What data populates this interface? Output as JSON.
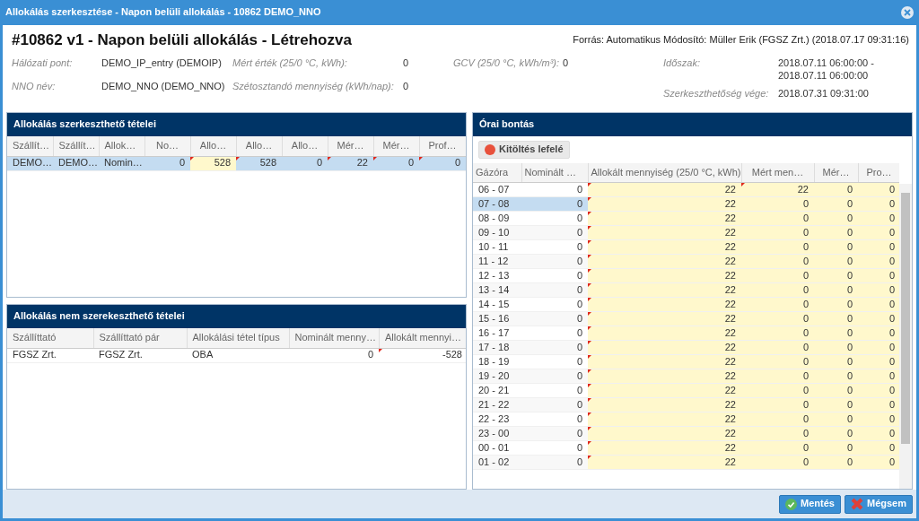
{
  "window": {
    "title": "Allokálás szerkesztése - Napon belüli allokálás - 10862 DEMO_NNO"
  },
  "header": {
    "title": "#10862 v1 - Napon belüli allokálás - Létrehozva",
    "source": "Forrás: Automatikus Módosító: Müller Erik (FGSZ Zrt.) (2018.07.17 09:31:16)",
    "fields": [
      {
        "label": "Hálózati pont:",
        "value": "DEMO_IP_entry (DEMOIP)"
      },
      {
        "label": "Mért érték (25/0 °C, kWh):",
        "value": "0"
      },
      {
        "label": "GCV (25/0 °C, kWh/m³):",
        "value": "0"
      },
      {
        "label": "NNO név:",
        "value": "DEMO_NNO (DEMO_NNO)"
      },
      {
        "label": "Szétosztandó mennyiség (kWh/nap):",
        "value": "0"
      }
    ],
    "period_fields": [
      {
        "label": "Időszak:",
        "value": "2018.07.11 06:00:00 - 2018.07.11 06:00:00"
      },
      {
        "label": "Szerkeszthetőség vége:",
        "value": "2018.07.31 09:31:00"
      }
    ]
  },
  "editable_items": {
    "title": "Allokálás szerkeszthető tételei",
    "columns": [
      "Szállít…",
      "Szállít…",
      "Allok…",
      "No…",
      "Allo…",
      "Allo…",
      "Allo…",
      "Mér…",
      "Mér…",
      "Prof…"
    ],
    "rows": [
      {
        "selected": true,
        "cells": [
          {
            "text": "DEMO…",
            "editable": false,
            "modified": false
          },
          {
            "text": "DEMO…",
            "editable": false,
            "modified": false
          },
          {
            "text": "Nomin…",
            "editable": false,
            "modified": false
          },
          {
            "text": "0",
            "editable": false,
            "modified": false
          },
          {
            "text": "528",
            "editable": true,
            "modified": true
          },
          {
            "text": "528",
            "editable": false,
            "modified": true
          },
          {
            "text": "0",
            "editable": false,
            "modified": false
          },
          {
            "text": "22",
            "editable": false,
            "modified": true
          },
          {
            "text": "0",
            "editable": false,
            "modified": true
          },
          {
            "text": "0",
            "editable": false,
            "modified": true
          }
        ]
      }
    ]
  },
  "fixed_items": {
    "title": "Allokálás nem szerekeszthető tételei",
    "columns": [
      "Szállíttató",
      "Szállíttató pár",
      "Allokálási tétel típus",
      "Nominált menny…",
      "Allokált mennyi…"
    ],
    "rows": [
      {
        "selected": false,
        "cells": [
          {
            "text": "FGSZ Zrt.",
            "editable": false,
            "modified": false
          },
          {
            "text": "FGSZ Zrt.",
            "editable": false,
            "modified": false
          },
          {
            "text": "OBA",
            "editable": false,
            "modified": false
          },
          {
            "text": "0",
            "editable": false,
            "modified": false
          },
          {
            "text": "-528",
            "editable": false,
            "modified": true
          }
        ]
      }
    ]
  },
  "hourly": {
    "title": "Órai bontás",
    "fill_button": "Kitöltés lefelé",
    "columns": [
      {
        "label": "Gázóra",
        "editable": false
      },
      {
        "label": "Nominált …",
        "editable": false
      },
      {
        "label": "Allokált mennyiség (25/0 °C, kWh)",
        "editable": true
      },
      {
        "label": "Mért men…",
        "editable": true
      },
      {
        "label": "Mér…",
        "editable": true
      },
      {
        "label": "Pro…",
        "editable": true
      }
    ],
    "rows": [
      {
        "selected": false,
        "cells": [
          "06 - 07",
          "0",
          "22",
          "22",
          "0",
          "0"
        ],
        "modified": [
          false,
          false,
          true,
          true,
          false,
          false
        ]
      },
      {
        "selected": true,
        "cells": [
          "07 - 08",
          "0",
          "22",
          "0",
          "0",
          "0"
        ],
        "modified": [
          false,
          false,
          true,
          false,
          false,
          false
        ]
      },
      {
        "selected": false,
        "cells": [
          "08 - 09",
          "0",
          "22",
          "0",
          "0",
          "0"
        ],
        "modified": [
          false,
          false,
          true,
          false,
          false,
          false
        ]
      },
      {
        "selected": false,
        "cells": [
          "09 - 10",
          "0",
          "22",
          "0",
          "0",
          "0"
        ],
        "modified": [
          false,
          false,
          true,
          false,
          false,
          false
        ]
      },
      {
        "selected": false,
        "cells": [
          "10 - 11",
          "0",
          "22",
          "0",
          "0",
          "0"
        ],
        "modified": [
          false,
          false,
          true,
          false,
          false,
          false
        ]
      },
      {
        "selected": false,
        "cells": [
          "11 - 12",
          "0",
          "22",
          "0",
          "0",
          "0"
        ],
        "modified": [
          false,
          false,
          true,
          false,
          false,
          false
        ]
      },
      {
        "selected": false,
        "cells": [
          "12 - 13",
          "0",
          "22",
          "0",
          "0",
          "0"
        ],
        "modified": [
          false,
          false,
          true,
          false,
          false,
          false
        ]
      },
      {
        "selected": false,
        "cells": [
          "13 - 14",
          "0",
          "22",
          "0",
          "0",
          "0"
        ],
        "modified": [
          false,
          false,
          true,
          false,
          false,
          false
        ]
      },
      {
        "selected": false,
        "cells": [
          "14 - 15",
          "0",
          "22",
          "0",
          "0",
          "0"
        ],
        "modified": [
          false,
          false,
          true,
          false,
          false,
          false
        ]
      },
      {
        "selected": false,
        "cells": [
          "15 - 16",
          "0",
          "22",
          "0",
          "0",
          "0"
        ],
        "modified": [
          false,
          false,
          true,
          false,
          false,
          false
        ]
      },
      {
        "selected": false,
        "cells": [
          "16 - 17",
          "0",
          "22",
          "0",
          "0",
          "0"
        ],
        "modified": [
          false,
          false,
          true,
          false,
          false,
          false
        ]
      },
      {
        "selected": false,
        "cells": [
          "17 - 18",
          "0",
          "22",
          "0",
          "0",
          "0"
        ],
        "modified": [
          false,
          false,
          true,
          false,
          false,
          false
        ]
      },
      {
        "selected": false,
        "cells": [
          "18 - 19",
          "0",
          "22",
          "0",
          "0",
          "0"
        ],
        "modified": [
          false,
          false,
          true,
          false,
          false,
          false
        ]
      },
      {
        "selected": false,
        "cells": [
          "19 - 20",
          "0",
          "22",
          "0",
          "0",
          "0"
        ],
        "modified": [
          false,
          false,
          true,
          false,
          false,
          false
        ]
      },
      {
        "selected": false,
        "cells": [
          "20 - 21",
          "0",
          "22",
          "0",
          "0",
          "0"
        ],
        "modified": [
          false,
          false,
          true,
          false,
          false,
          false
        ]
      },
      {
        "selected": false,
        "cells": [
          "21 - 22",
          "0",
          "22",
          "0",
          "0",
          "0"
        ],
        "modified": [
          false,
          false,
          true,
          false,
          false,
          false
        ]
      },
      {
        "selected": false,
        "cells": [
          "22 - 23",
          "0",
          "22",
          "0",
          "0",
          "0"
        ],
        "modified": [
          false,
          false,
          true,
          false,
          false,
          false
        ]
      },
      {
        "selected": false,
        "cells": [
          "23 - 00",
          "0",
          "22",
          "0",
          "0",
          "0"
        ],
        "modified": [
          false,
          false,
          true,
          false,
          false,
          false
        ]
      },
      {
        "selected": false,
        "cells": [
          "00 - 01",
          "0",
          "22",
          "0",
          "0",
          "0"
        ],
        "modified": [
          false,
          false,
          true,
          false,
          false,
          false
        ]
      },
      {
        "selected": false,
        "cells": [
          "01 - 02",
          "0",
          "22",
          "0",
          "0",
          "0"
        ],
        "modified": [
          false,
          false,
          true,
          false,
          false,
          false
        ]
      }
    ]
  },
  "buttons": [
    {
      "label": "Mentés",
      "kind": "save"
    },
    {
      "label": "Mégsem",
      "kind": "cancel"
    }
  ]
}
